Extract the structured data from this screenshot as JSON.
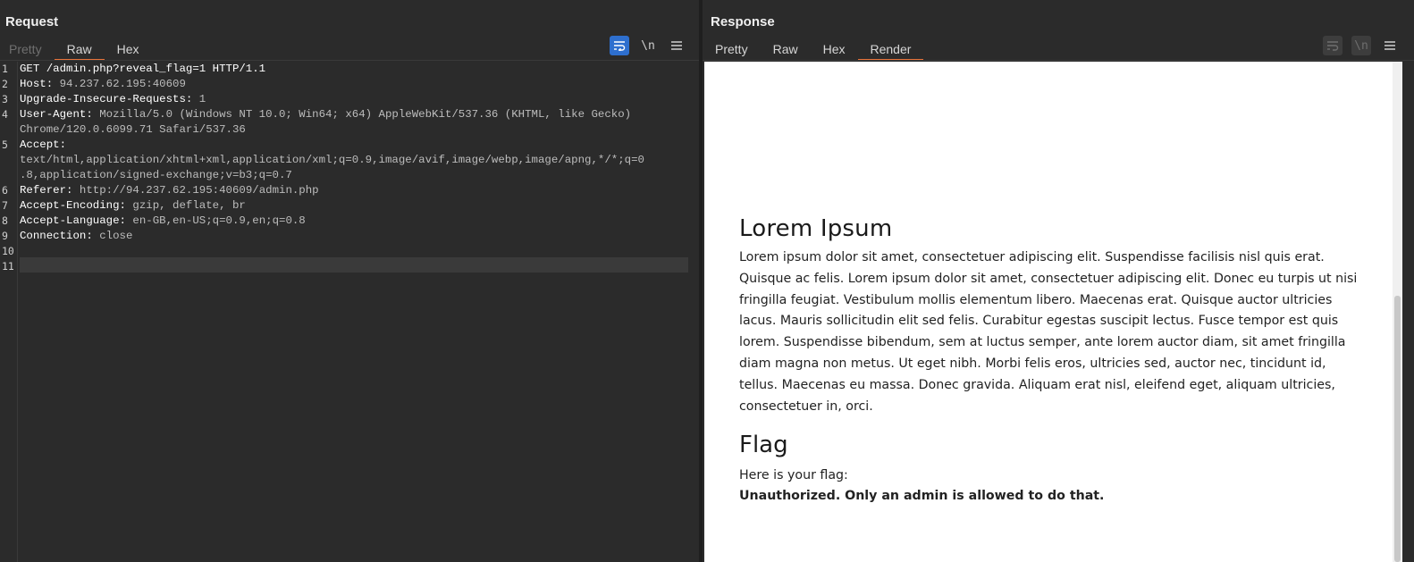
{
  "request": {
    "title": "Request",
    "tabs": [
      {
        "label": "Pretty",
        "state": "dim"
      },
      {
        "label": "Raw",
        "state": "active"
      },
      {
        "label": "Hex",
        "state": "normal"
      }
    ],
    "tools": {
      "newline_label": "\\n"
    },
    "line_numbers": [
      "1",
      "2",
      "3",
      "4",
      "",
      "5",
      "",
      "",
      "6",
      "7",
      "8",
      "9",
      "10",
      "11"
    ],
    "lines": [
      {
        "key": "GET /admin.php?reveal_flag=1 HTTP/1.1",
        "val": ""
      },
      {
        "key": "Host:",
        "val": " 94.237.62.195:40609"
      },
      {
        "key": "Upgrade-Insecure-Requests:",
        "val": " 1"
      },
      {
        "key": "User-Agent:",
        "val": " Mozilla/5.0 (Windows NT 10.0; Win64; x64) AppleWebKit/537.36 (KHTML, like Gecko)"
      },
      {
        "key": "",
        "val": "Chrome/120.0.6099.71 Safari/537.36"
      },
      {
        "key": "Accept:",
        "val": ""
      },
      {
        "key": "",
        "val": "text/html,application/xhtml+xml,application/xml;q=0.9,image/avif,image/webp,image/apng,*/*;q=0"
      },
      {
        "key": "",
        "val": ".8,application/signed-exchange;v=b3;q=0.7"
      },
      {
        "key": "Referer:",
        "val": " http://94.237.62.195:40609/admin.php"
      },
      {
        "key": "Accept-Encoding:",
        "val": " gzip, deflate, br"
      },
      {
        "key": "Accept-Language:",
        "val": " en-GB,en-US;q=0.9,en;q=0.8"
      },
      {
        "key": "Connection:",
        "val": " close"
      },
      {
        "key": "",
        "val": ""
      },
      {
        "key": "",
        "val": ""
      }
    ]
  },
  "response": {
    "title": "Response",
    "tabs": [
      {
        "label": "Pretty",
        "state": "normal"
      },
      {
        "label": "Raw",
        "state": "normal"
      },
      {
        "label": "Hex",
        "state": "normal"
      },
      {
        "label": "Render",
        "state": "active"
      }
    ],
    "tools": {
      "newline_label": "\\n"
    },
    "render": {
      "heading": "Lorem Ipsum",
      "paragraph": "Lorem ipsum dolor sit amet, consectetuer adipiscing elit. Suspendisse facilisis nisl quis erat. Quisque ac felis. Lorem ipsum dolor sit amet, consectetuer adipiscing elit. Donec eu turpis ut nisi fringilla feugiat. Vestibulum mollis elementum libero. Maecenas erat. Quisque auctor ultricies lacus. Mauris sollicitudin elit sed felis. Curabitur egestas suscipit lectus. Fusce tempor est quis lorem. Suspendisse bibendum, sem at luctus semper, ante lorem auctor diam, sit amet fringilla diam magna non metus. Ut eget nibh. Morbi felis eros, ultricies sed, auctor nec, tincidunt id, tellus. Maecenas eu massa. Donec gravida. Aliquam erat nisl, eleifend eget, aliquam ultricies, consectetuer in, orci.",
      "flag_heading": "Flag",
      "flag_label": "Here is your flag:",
      "flag_value": "Unauthorized. Only an admin is allowed to do that."
    }
  },
  "colors": {
    "accent_tab": "#e8733a",
    "accent_button": "#2e6fce",
    "panel_bg": "#2b2b2b"
  }
}
